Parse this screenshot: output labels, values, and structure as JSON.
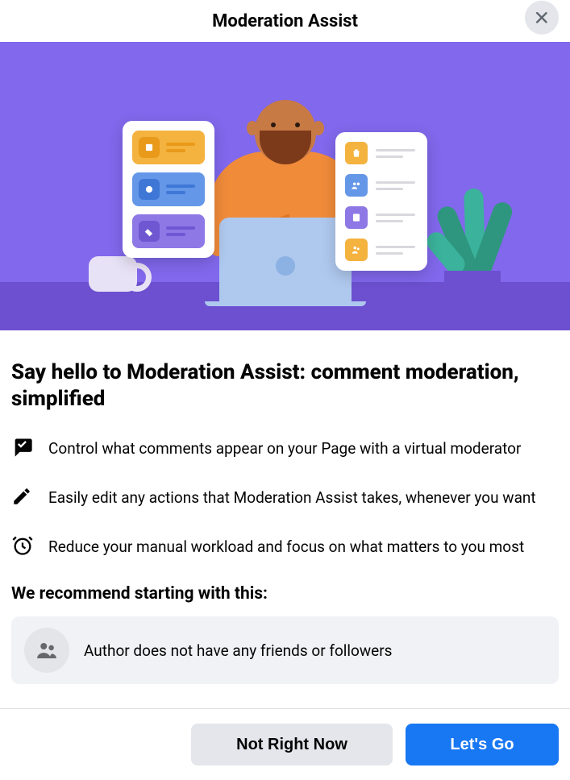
{
  "header": {
    "title": "Moderation Assist"
  },
  "headline": "Say hello to Moderation Assist: comment moderation, simplified",
  "features": [
    {
      "icon": "chat-check-icon",
      "text": "Control what comments appear on your Page with a virtual moderator"
    },
    {
      "icon": "pencil-icon",
      "text": "Easily edit any actions that Moderation Assist takes, whenever you want"
    },
    {
      "icon": "alarm-icon",
      "text": "Reduce your manual workload and focus on what matters to you most"
    }
  ],
  "recommend": {
    "title": "We recommend starting with this:",
    "item": {
      "icon": "people-icon",
      "text": "Author does not have any friends or followers"
    }
  },
  "footer": {
    "secondary": "Not Right Now",
    "primary": "Let's Go"
  }
}
